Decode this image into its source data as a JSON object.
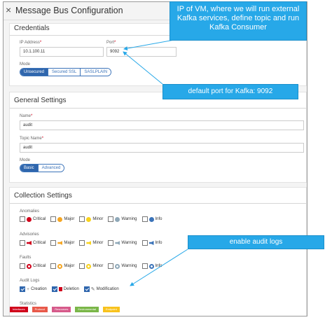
{
  "window": {
    "title": "Message Bus Configuration",
    "close_glyph": "×"
  },
  "credentials": {
    "title": "Credentials",
    "ip_label": "IP Address",
    "ip_value": "10.1.100.11",
    "port_label": "Port",
    "port_value": "9092",
    "required_mark": "*",
    "mode_label": "Mode",
    "modes": [
      "Unsecured",
      "Secured SSL",
      "SASLPLAIN"
    ],
    "active_mode": "Unsecured"
  },
  "general": {
    "title": "General Settings",
    "name_label": "Name",
    "name_value": "audit",
    "topic_label": "Topic Name",
    "topic_value": "audit",
    "required_mark": "*",
    "mode_label": "Mode",
    "modes": [
      "Basic",
      "Advanced"
    ],
    "active_mode": "Basic"
  },
  "collection": {
    "title": "Collection Settings",
    "anomalies": {
      "label": "Anomalies",
      "items": [
        {
          "label": "Critical",
          "checked": false,
          "icon": "critical-icon",
          "color": "#d0021b"
        },
        {
          "label": "Major",
          "checked": false,
          "icon": "major-icon",
          "color": "#f5a623"
        },
        {
          "label": "Minor",
          "checked": false,
          "icon": "minor-icon",
          "color": "#f8d21c"
        },
        {
          "label": "Warning",
          "checked": false,
          "icon": "warning-icon",
          "color": "#8fa8b8"
        },
        {
          "label": "Info",
          "checked": false,
          "icon": "info-icon",
          "color": "#3b73b9"
        }
      ]
    },
    "advisories": {
      "label": "Advisories",
      "items": [
        {
          "label": "Critical",
          "checked": false,
          "icon": "megaphone-icon",
          "color": "#d0021b"
        },
        {
          "label": "Major",
          "checked": false,
          "icon": "megaphone-icon",
          "color": "#f5a623"
        },
        {
          "label": "Minor",
          "checked": false,
          "icon": "megaphone-icon",
          "color": "#f8d21c"
        },
        {
          "label": "Warning",
          "checked": false,
          "icon": "megaphone-icon",
          "color": "#8fa8b8"
        },
        {
          "label": "Info",
          "checked": false,
          "icon": "megaphone-icon",
          "color": "#3b73b9"
        }
      ]
    },
    "faults": {
      "label": "Faults",
      "items": [
        {
          "label": "Critical",
          "checked": false,
          "icon": "fault-critical-icon",
          "color": "#d0021b"
        },
        {
          "label": "Major",
          "checked": false,
          "icon": "fault-major-icon",
          "color": "#f5a623"
        },
        {
          "label": "Minor",
          "checked": false,
          "icon": "fault-minor-icon",
          "color": "#f8d21c"
        },
        {
          "label": "Warning",
          "checked": false,
          "icon": "fault-warning-icon",
          "color": "#8fa8b8"
        },
        {
          "label": "Info",
          "checked": false,
          "icon": "fault-info-icon",
          "color": "#3b73b9"
        }
      ]
    },
    "audit_logs": {
      "label": "Audit Logs",
      "items": [
        {
          "label": "Creation",
          "checked": true,
          "icon": "plus-icon",
          "color": "#888888"
        },
        {
          "label": "Deletion",
          "checked": true,
          "icon": "trash-icon",
          "color": "#d0021b"
        },
        {
          "label": "Modification",
          "checked": true,
          "icon": "pencil-icon",
          "color": "#666666"
        }
      ]
    },
    "statistics": {
      "label": "Statistics",
      "tags": [
        {
          "label": "Interfaces",
          "color": "#d0021b"
        },
        {
          "label": "Protocol",
          "color": "#e8594a"
        },
        {
          "label": "Resources",
          "color": "#d65a8a"
        },
        {
          "label": "Environmental",
          "color": "#7ab648"
        },
        {
          "label": "Endpoint",
          "color": "#f8c21c"
        }
      ]
    }
  },
  "callouts": {
    "ip": "IP of VM, where we will run external Kafka services, define topic and run Kafka Consumer",
    "port": "default port for Kafka: 9092",
    "audit": "enable audit logs",
    "color": "#27a8e8"
  }
}
